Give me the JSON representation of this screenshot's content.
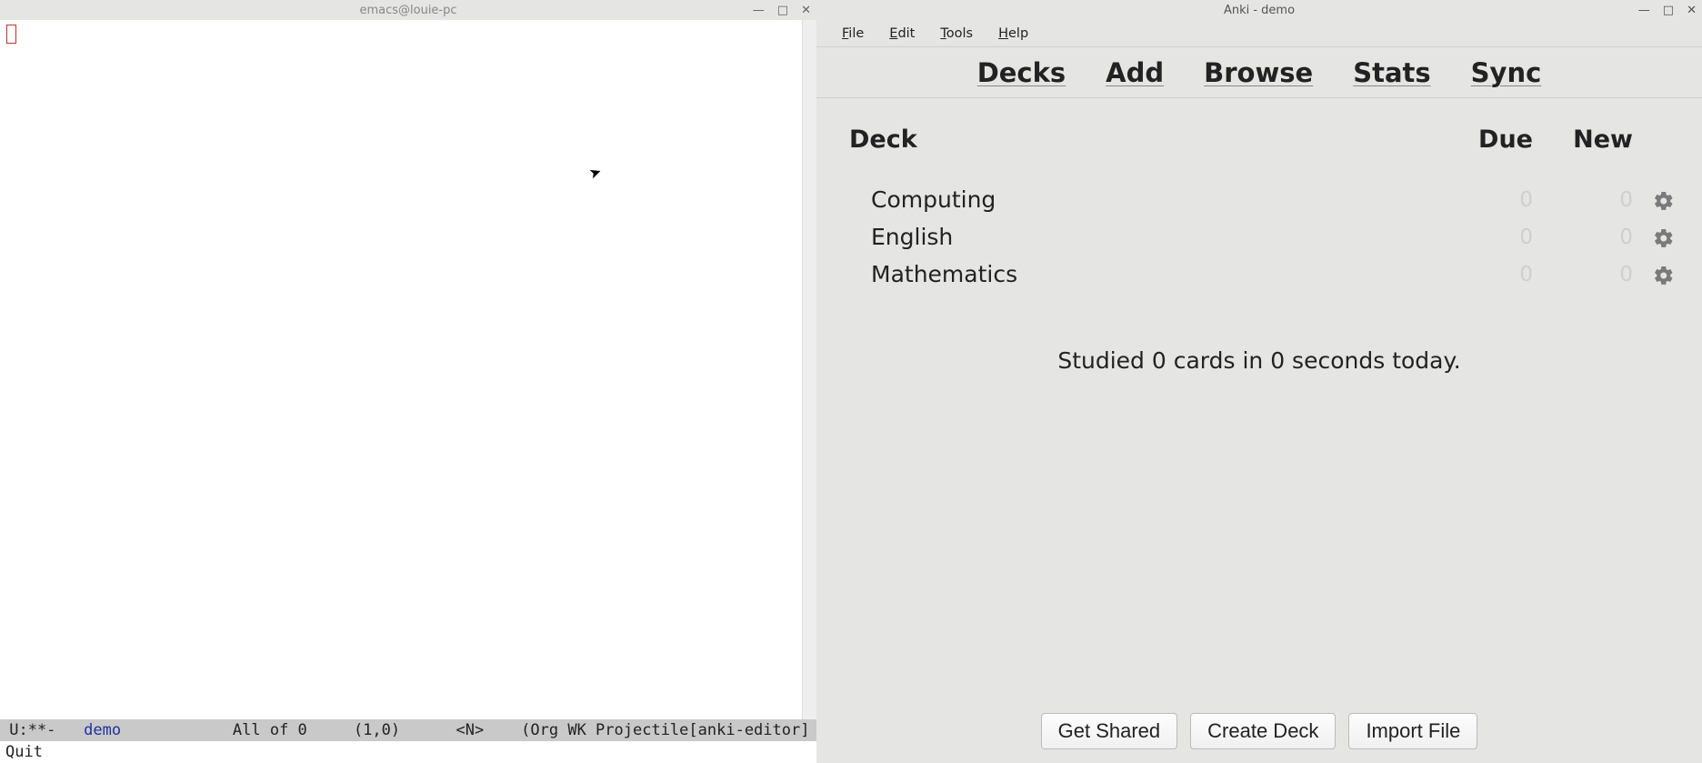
{
  "emacs": {
    "title": "emacs@louie-pc",
    "modeline_prefix": " U:**-   ",
    "buffer_name": "demo",
    "modeline_mid": "            All of 0     (1,0)      <N>    (Org WK Projectile[anki-editor]",
    "minibuffer": "Quit"
  },
  "anki": {
    "title": "Anki - demo",
    "menubar": {
      "file": "File",
      "edit": "Edit",
      "tools": "Tools",
      "help": "Help"
    },
    "toolbar": {
      "decks": "Decks",
      "add": "Add",
      "browse": "Browse",
      "stats": "Stats",
      "sync": "Sync"
    },
    "headers": {
      "deck": "Deck",
      "due": "Due",
      "new": "New"
    },
    "decks": [
      {
        "name": "Computing",
        "due": "0",
        "new": "0"
      },
      {
        "name": "English",
        "due": "0",
        "new": "0"
      },
      {
        "name": "Mathematics",
        "due": "0",
        "new": "0"
      }
    ],
    "status": "Studied 0 cards in 0 seconds today.",
    "buttons": {
      "shared": "Get Shared",
      "create": "Create Deck",
      "import": "Import File"
    }
  }
}
